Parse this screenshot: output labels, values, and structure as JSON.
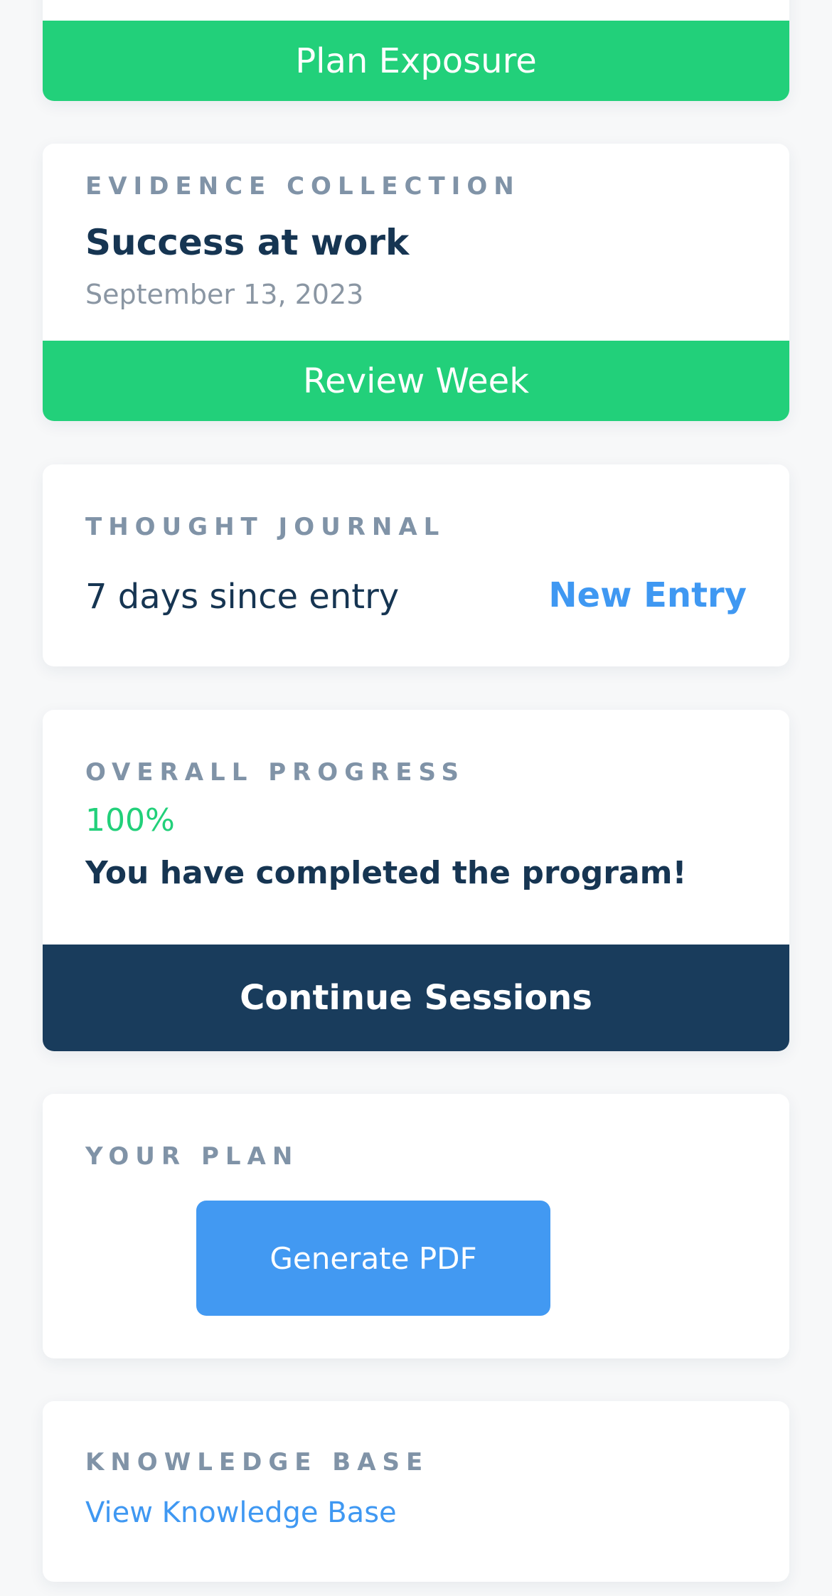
{
  "plan_card": {
    "button_label": "Plan Exposure"
  },
  "evidence": {
    "heading": "EVIDENCE COLLECTION",
    "title": "Success at work",
    "date": "September 13, 2023",
    "button_label": "Review Week"
  },
  "journal": {
    "heading": "THOUGHT JOURNAL",
    "status": "7 days since entry",
    "action_label": "New Entry"
  },
  "progress": {
    "heading": "OVERALL PROGRESS",
    "percent_text": "100%",
    "percent_value": 100,
    "message": "You have completed the program!",
    "button_label": "Continue Sessions"
  },
  "plan": {
    "heading": "YOUR PLAN",
    "button_label": "Generate PDF"
  },
  "knowledge": {
    "heading": "KNOWLEDGE BASE",
    "link_label": "View Knowledge Base"
  },
  "colors": {
    "green": "#22d07a",
    "navy": "#193c5c",
    "blue": "#3f98f2",
    "heading_gray": "#8093a7",
    "text_dark": "#163552"
  }
}
